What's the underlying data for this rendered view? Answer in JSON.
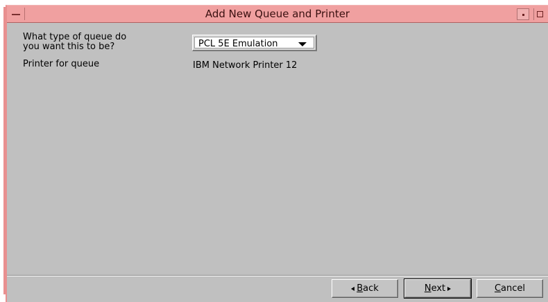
{
  "window": {
    "title": "Add New Queue and Printer"
  },
  "form": {
    "queue_type_label_line1": "What type of queue do",
    "queue_type_label_line2": "you want this to be?",
    "queue_type_value": "PCL 5E Emulation",
    "printer_label": "Printer for queue",
    "printer_value": "IBM Network Printer 12"
  },
  "buttons": {
    "back_label": "Back",
    "back_mnemonic": "B",
    "back_rest": "ack",
    "next_label": "Next",
    "next_mnemonic": "N",
    "next_rest": "ext",
    "cancel_label": "Cancel",
    "cancel_mnemonic": "C",
    "cancel_rest": "ancel"
  },
  "colors": {
    "titlebar": "#f0a0a0",
    "window_bg": "#c0c0c0"
  },
  "icons": [
    "window-menu-icon",
    "minimize-icon",
    "maximize-icon",
    "dropdown-arrow-icon",
    "back-arrow-icon",
    "next-arrow-icon"
  ]
}
